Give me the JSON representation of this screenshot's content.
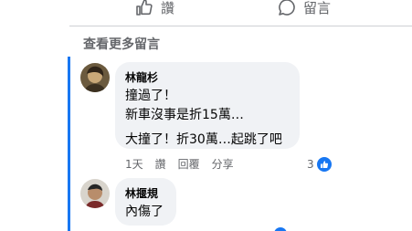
{
  "actions": {
    "like_label": "讚",
    "comment_label": "留言"
  },
  "more_comments": "查看更多留言",
  "comments": [
    {
      "author": "林龍杉",
      "lines": [
        "撞過了！",
        "新車沒事是折15萬…",
        "大撞了！折30萬…起跳了吧"
      ],
      "time": "1天",
      "like_label": "讚",
      "reply_label": "回覆",
      "share_label": "分享",
      "reaction_count": "3"
    },
    {
      "author": "林揠規",
      "lines": [
        "內傷了"
      ]
    }
  ],
  "colors": {
    "accent": "#1877f2",
    "bubble": "#f0f2f5",
    "secondary_text": "#65676b"
  }
}
